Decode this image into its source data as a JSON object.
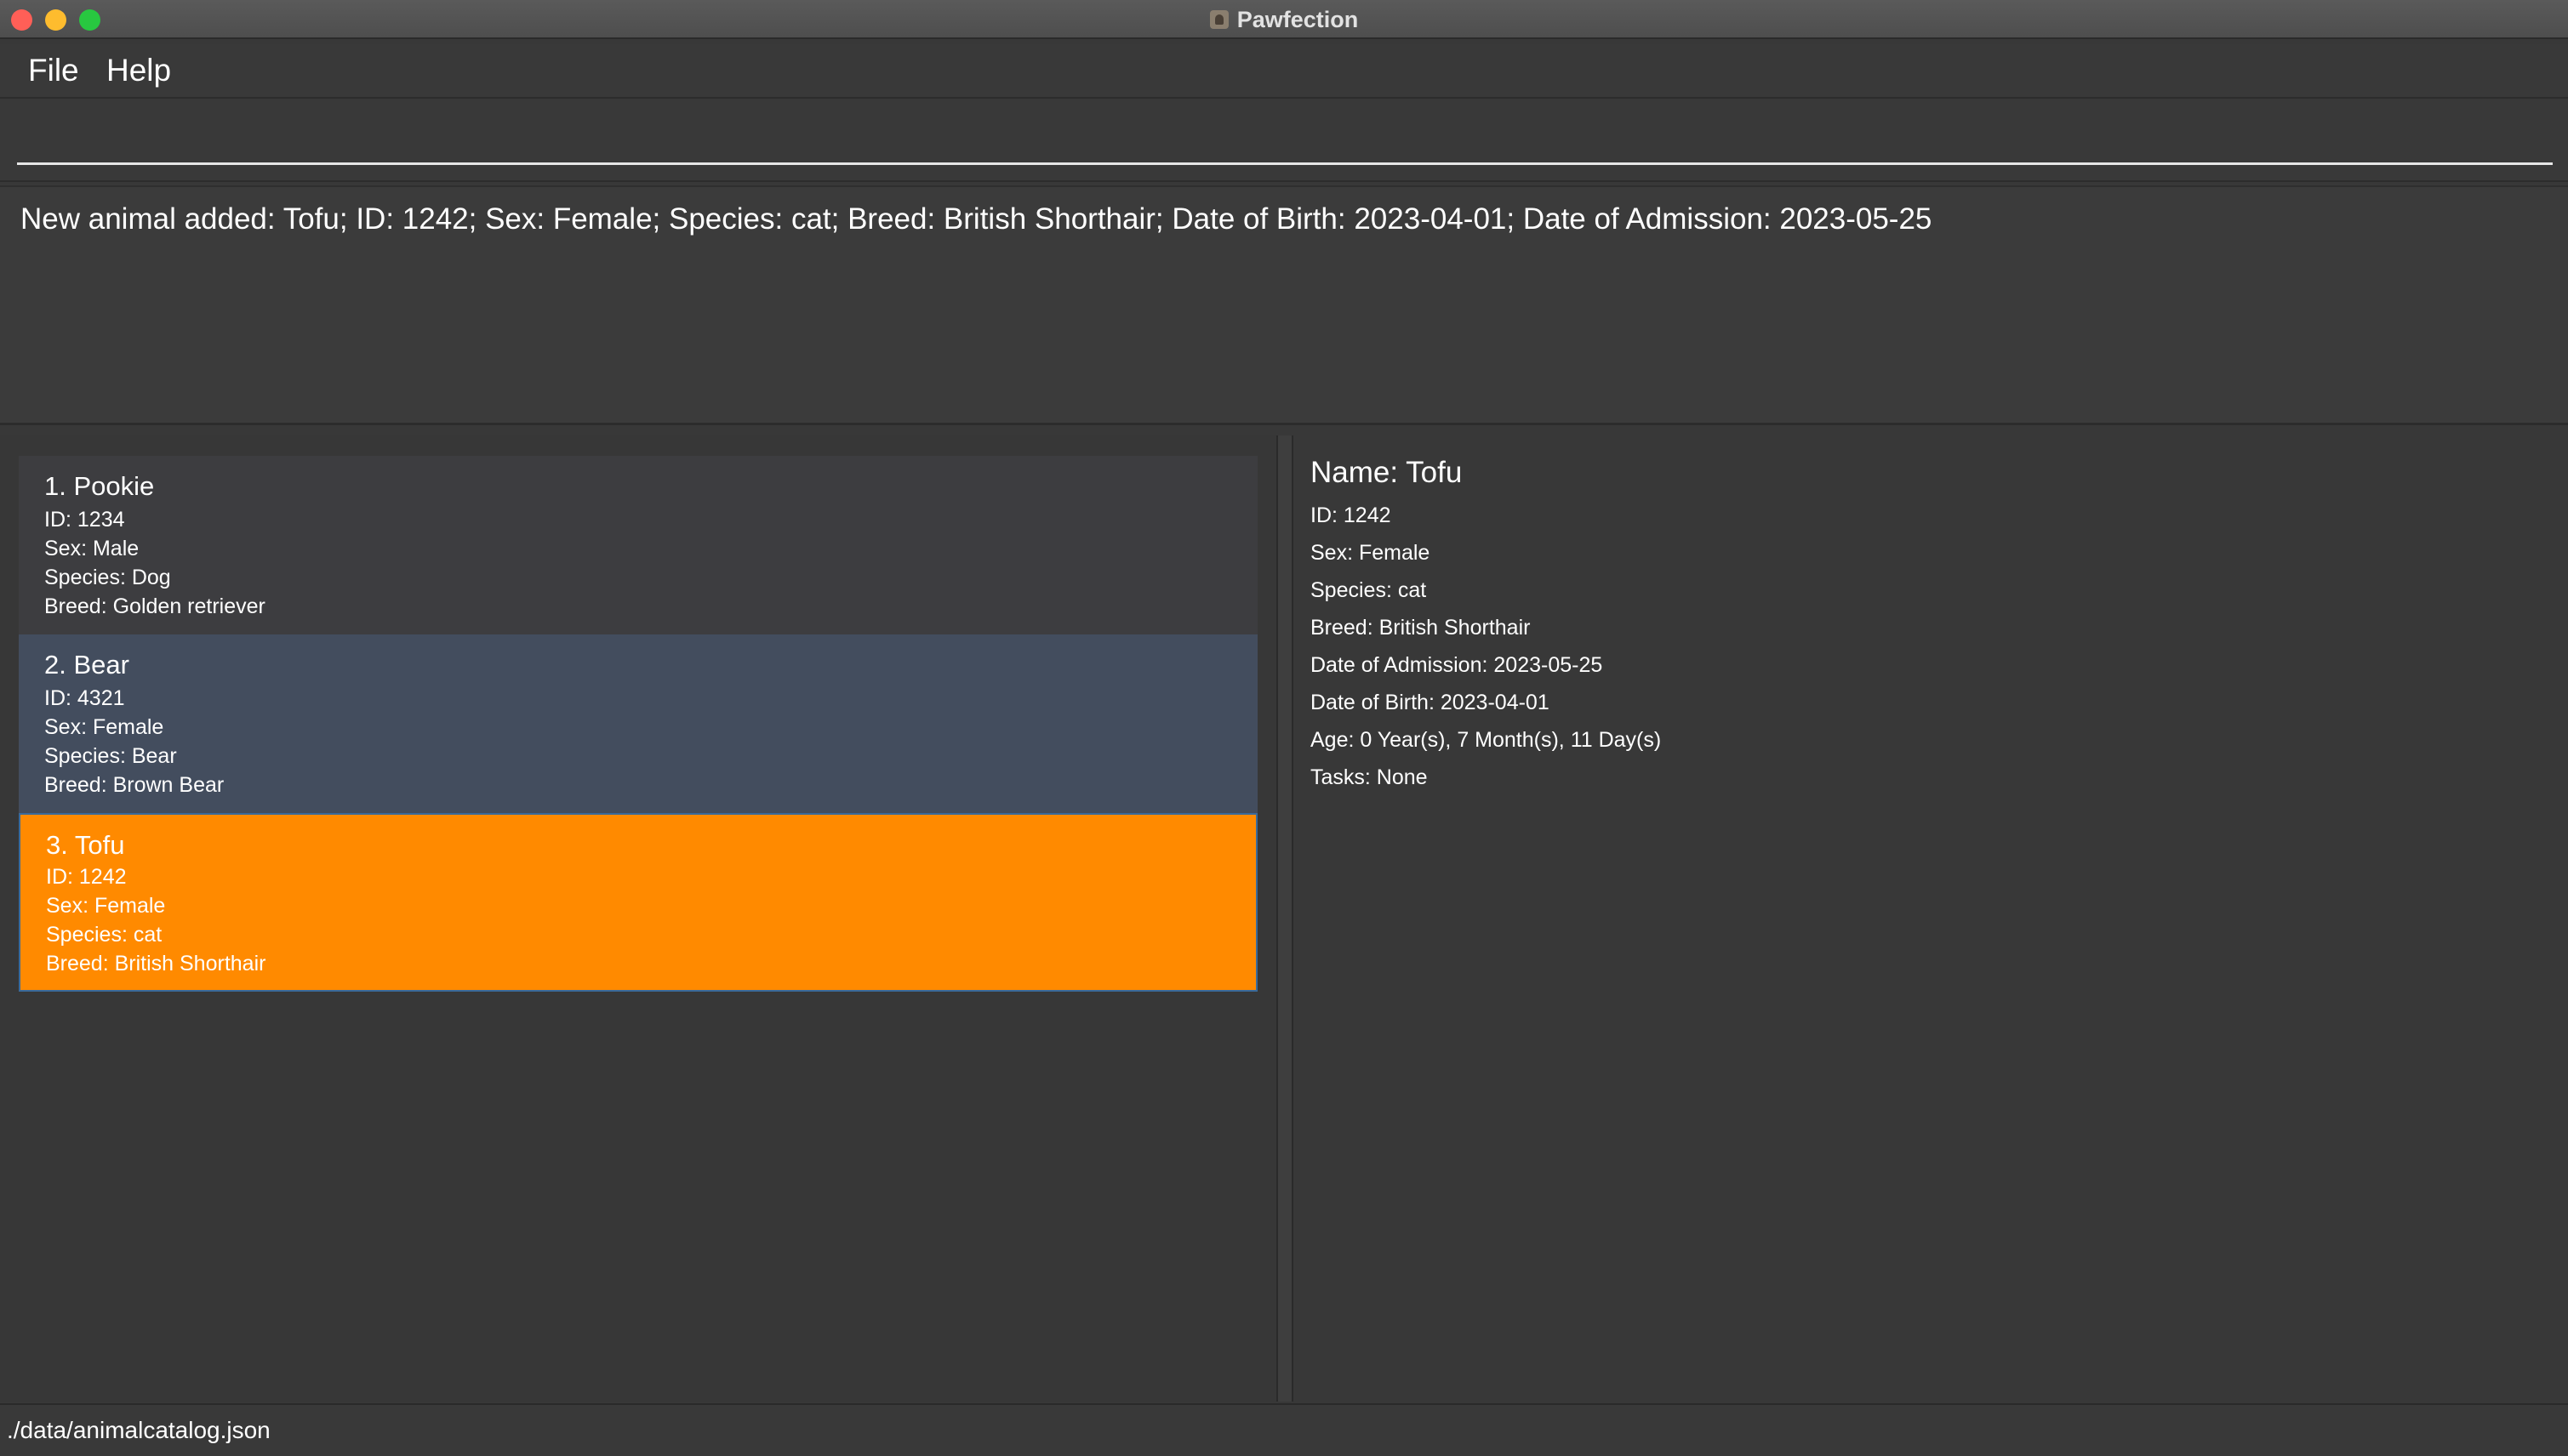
{
  "window": {
    "title": "Pawfection"
  },
  "menu": {
    "file": "File",
    "help": "Help"
  },
  "command": {
    "value": "",
    "placeholder": ""
  },
  "result": {
    "text": "New animal added: Tofu; ID: 1242; Sex: Female; Species: cat; Breed: British Shorthair; Date of Birth: 2023-04-01; Date of Admission: 2023-05-25"
  },
  "animals": [
    {
      "name": "1.  Pookie",
      "id": "ID: 1234",
      "sex": "Sex: Male",
      "species": "Species: Dog",
      "breed": "Breed: Golden retriever"
    },
    {
      "name": "2.  Bear",
      "id": "ID: 4321",
      "sex": "Sex: Female",
      "species": "Species: Bear",
      "breed": "Breed: Brown Bear"
    },
    {
      "name": "3.  Tofu",
      "id": "ID: 1242",
      "sex": "Sex: Female",
      "species": "Species: cat",
      "breed": "Breed: British Shorthair"
    }
  ],
  "detail": {
    "name": "Name: Tofu",
    "id": "ID: 1242",
    "sex": "Sex: Female",
    "species": "Species: cat",
    "breed": "Breed: British Shorthair",
    "admission": "Date of Admission: 2023-05-25",
    "birth": "Date of Birth: 2023-04-01",
    "age": "Age: 0 Year(s), 7 Month(s), 11 Day(s)",
    "tasks": "Tasks: None"
  },
  "status": {
    "path": "./data/animalcatalog.json"
  },
  "colors": {
    "background": "#383838",
    "selected_card": "#ff8a00",
    "hover_card": "#434d5e",
    "card": "#3d3d40"
  }
}
